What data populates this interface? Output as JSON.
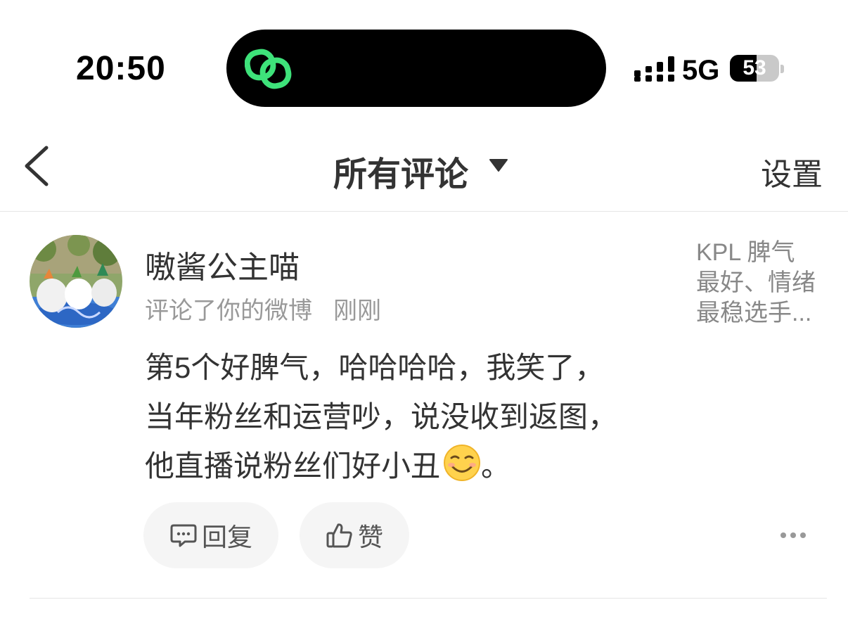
{
  "status_bar": {
    "time": "20:50",
    "network": "5G",
    "battery_level": "53",
    "island_app_icon": "link-app-icon"
  },
  "nav": {
    "title": "所有评论",
    "settings_label": "设置",
    "back_icon": "chevron-left-icon",
    "dropdown_icon": "caret-down-icon"
  },
  "comment": {
    "username": "嗷酱公主喵",
    "action_text": "评论了你的微博",
    "time_text": "刚刚",
    "content_lines": [
      "第5个好脾气，哈哈哈哈，我笑了，",
      "当年粉丝和运营吵，说没收到返图，",
      "他直播说粉丝们好小丑"
    ],
    "content_end": "。",
    "emoji": "smirk-emoji",
    "origin_post_excerpt": [
      "KPL 脾气",
      "最好、情绪",
      "最稳选手..."
    ],
    "reply_label": "回复",
    "like_label": "赞"
  },
  "colors": {
    "accent_green": "#3ee27a",
    "text_primary": "#333333",
    "text_secondary": "#999999",
    "pill_bg": "#f5f5f5"
  }
}
